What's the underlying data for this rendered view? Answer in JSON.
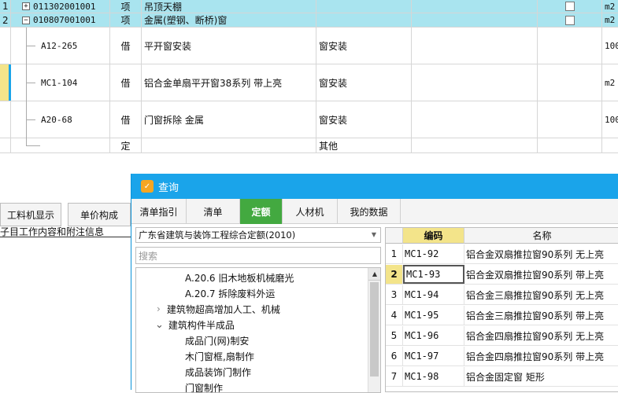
{
  "grid": {
    "rows": [
      {
        "num": "1",
        "expander": "+",
        "code": "011302001001",
        "type": "项",
        "name": "吊顶天棚",
        "spec": "",
        "check": true,
        "unit": "m2"
      },
      {
        "num": "2",
        "expander": "−",
        "code": "010807001001",
        "type": "项",
        "name": "金属(塑钢、断桥)窗",
        "spec": "",
        "check": true,
        "unit": "m2"
      },
      {
        "num": "",
        "code": "A12-265",
        "type": "借",
        "name": "平开窗安装",
        "spec": "窗安装",
        "unit": "100"
      },
      {
        "num": "",
        "code": "MC1-104",
        "type": "借",
        "name": "铝合金单扇平开窗38系列 带上亮",
        "spec": "窗安装",
        "unit": "m2"
      },
      {
        "num": "",
        "code": "A20-68",
        "type": "借",
        "name": "门窗拆除 金属",
        "spec": "窗安装",
        "unit": "100"
      },
      {
        "num": "",
        "code": "",
        "type": "定",
        "name": "",
        "spec": "其他",
        "unit": ""
      }
    ]
  },
  "bottom_tabs": [
    "工料机显示",
    "单价构成"
  ],
  "bottom_info": "子目工作内容和附注信息",
  "dialog": {
    "title": "查询",
    "tabs": [
      "清单指引",
      "清单",
      "定额",
      "人材机",
      "我的数据"
    ],
    "active_tab": "定额",
    "selected_quota": "广东省建筑与装饰工程综合定额(2010)",
    "search_placeholder": "搜索",
    "tree": [
      {
        "label": "A.20.6 旧木地板机械磨光",
        "indent": 3,
        "arrow": ""
      },
      {
        "label": "A.20.7 拆除废料外运",
        "indent": 3,
        "arrow": ""
      },
      {
        "label": "建筑物超高增加人工、机械",
        "indent": 1,
        "arrow": "›"
      },
      {
        "label": "建筑构件半成品",
        "indent": 1,
        "arrow": "⌄"
      },
      {
        "label": "成品门(网)制安",
        "indent": 2,
        "arrow": ""
      },
      {
        "label": "木门窗框,扇制作",
        "indent": 2,
        "arrow": ""
      },
      {
        "label": "成品装饰门制作",
        "indent": 2,
        "arrow": ""
      },
      {
        "label": "门窗制作",
        "indent": 2,
        "arrow": ""
      }
    ],
    "table": {
      "headers": [
        "",
        "编码",
        "名称"
      ],
      "rows": [
        {
          "num": "1",
          "code": "MC1-92",
          "name": "铝合金双扇推拉窗90系列 无上亮"
        },
        {
          "num": "2",
          "code": "MC1-93",
          "name": "铝合金双扇推拉窗90系列 带上亮"
        },
        {
          "num": "3",
          "code": "MC1-94",
          "name": "铝合金三扇推拉窗90系列 无上亮"
        },
        {
          "num": "4",
          "code": "MC1-95",
          "name": "铝合金三扇推拉窗90系列 带上亮"
        },
        {
          "num": "5",
          "code": "MC1-96",
          "name": "铝合金四扇推拉窗90系列 无上亮"
        },
        {
          "num": "6",
          "code": "MC1-97",
          "name": "铝合金四扇推拉窗90系列 带上亮"
        },
        {
          "num": "7",
          "code": "MC1-98",
          "name": "铝合金固定窗 矩形"
        }
      ],
      "selected_index": 1
    }
  },
  "colors": {
    "selection": "#a9e4ef",
    "title_bar": "#1aa4ea",
    "active_tab": "#43a940",
    "header_highlight": "#f3e48a"
  }
}
